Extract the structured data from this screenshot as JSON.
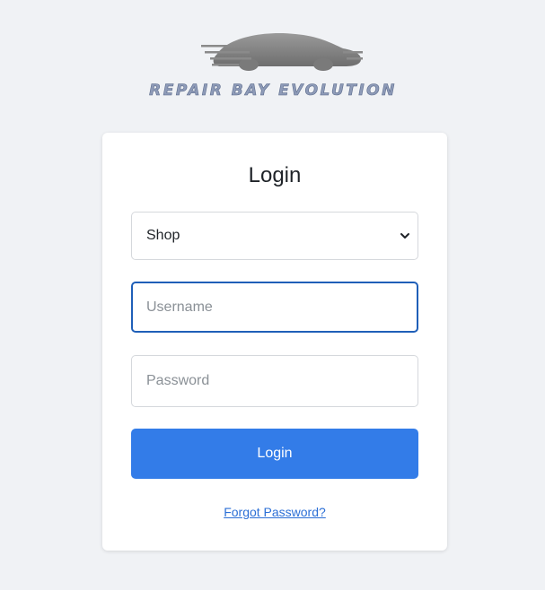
{
  "brand": {
    "logo_text": "REPAIR BAY EVOLUTION",
    "logo_icon": "car-silhouette-icon"
  },
  "login_card": {
    "title": "Login",
    "account_type": {
      "selected": "Shop",
      "options": [
        "Shop"
      ]
    },
    "username": {
      "value": "",
      "placeholder": "Username"
    },
    "password": {
      "value": "",
      "placeholder": "Password"
    },
    "submit_label": "Login",
    "forgot_password_label": "Forgot Password?"
  },
  "colors": {
    "background": "#f0f2f5",
    "primary": "#337ce8",
    "focus_border": "#1f5fb8",
    "link": "#2c6fd6"
  }
}
